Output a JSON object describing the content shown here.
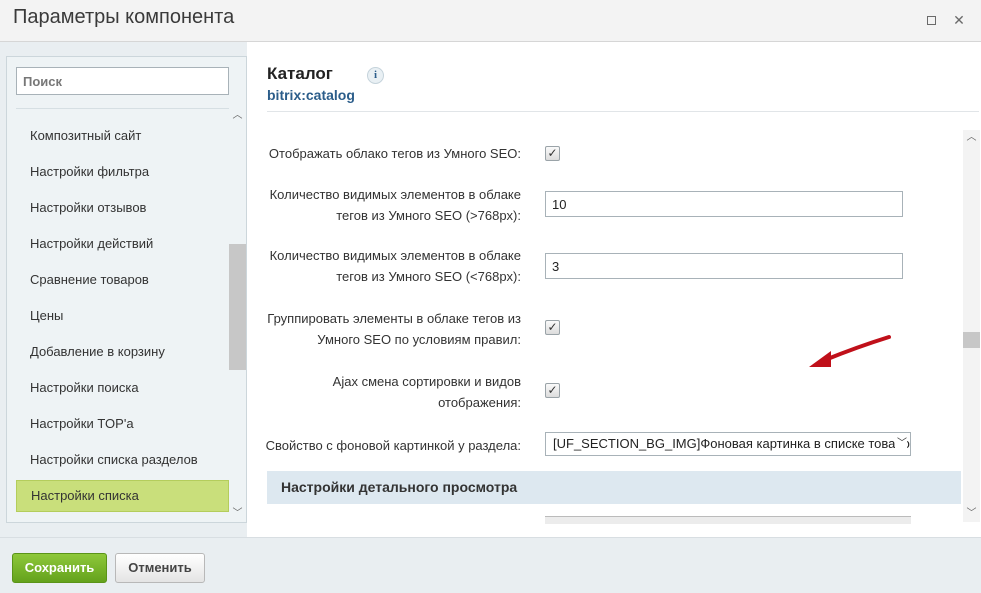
{
  "window": {
    "title": "Параметры компонента",
    "maximize_icon": "maximize-icon",
    "close_label": "✕"
  },
  "sidebar": {
    "search_placeholder": "Поиск",
    "items": [
      {
        "label": "Композитный сайт",
        "active": false
      },
      {
        "label": "Настройки фильтра",
        "active": false
      },
      {
        "label": "Настройки отзывов",
        "active": false
      },
      {
        "label": "Настройки действий",
        "active": false
      },
      {
        "label": "Сравнение товаров",
        "active": false
      },
      {
        "label": "Цены",
        "active": false
      },
      {
        "label": "Добавление в корзину",
        "active": false
      },
      {
        "label": "Настройки поиска",
        "active": false
      },
      {
        "label": "Настройки TOP'а",
        "active": false
      },
      {
        "label": "Настройки списка разделов",
        "active": false
      },
      {
        "label": "Настройки списка",
        "active": true
      }
    ],
    "accent_color": "#c9df7b"
  },
  "component": {
    "name": "Каталог",
    "code": "bitrix:catalog",
    "info_icon": "i"
  },
  "params": {
    "tags_cloud": {
      "label": "Отображать облако тегов из Умного SEO:",
      "checked": true
    },
    "tags_count_desktop": {
      "label": "Количество видимых элементов в облаке тегов из Умного SEO (>768px):",
      "value": "10"
    },
    "tags_count_mobile": {
      "label": "Количество видимых элементов в облаке тегов из Умного SEO (<768px):",
      "value": "3"
    },
    "group_tags": {
      "label": "Группировать элементы в облаке тегов из Умного SEO по условиям правил:",
      "checked": true
    },
    "ajax_sort": {
      "label": "Ajax смена сортировки и видов отображения:",
      "checked": true
    },
    "bg_property": {
      "label": "Свойство с фоновой картинкой у раздела:",
      "selected": "[UF_SECTION_BG_IMG]Фоновая картинка в списке товаров"
    }
  },
  "section_header": "Настройки детального просмотра",
  "annotation_arrow_color": "#c0101a",
  "footer": {
    "save_label": "Сохранить",
    "cancel_label": "Отменить"
  }
}
